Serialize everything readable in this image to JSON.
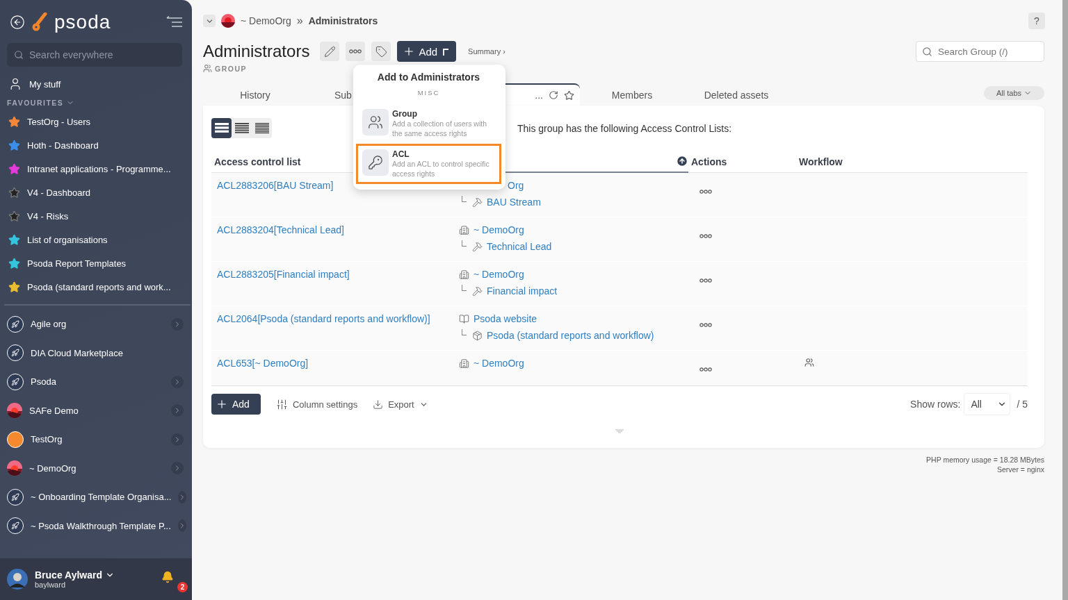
{
  "sidebar": {
    "logo": "psoda",
    "search": {
      "placeholder": "Search everywhere"
    },
    "my_stuff": "My stuff",
    "favourites_heading": "FAVOURITES",
    "favourites": [
      {
        "label": "TestOrg - Users",
        "color": "#f5873a"
      },
      {
        "label": "Hoth - Dashboard",
        "color": "#3b8fe8"
      },
      {
        "label": "Intranet applications - Programme...",
        "color": "#e33ad8"
      },
      {
        "label": "V4 - Dashboard",
        "color": "#222222"
      },
      {
        "label": "V4 - Risks",
        "color": "#222222"
      },
      {
        "label": "List of organisations",
        "color": "#35c4dc"
      },
      {
        "label": "Psoda Report Templates",
        "color": "#35c4dc"
      },
      {
        "label": "Psoda (standard reports and work...",
        "color": "#e8bd32"
      }
    ],
    "organisations": [
      {
        "label": "Agile org",
        "kind": "rocket",
        "expandable": true
      },
      {
        "label": "DIA Cloud Marketplace",
        "kind": "rocket",
        "expandable": false
      },
      {
        "label": "Psoda",
        "kind": "rocket",
        "expandable": true
      },
      {
        "label": "SAFe Demo",
        "kind": "picture",
        "expandable": true
      },
      {
        "label": "TestOrg",
        "kind": "orange",
        "expandable": true
      },
      {
        "label": "~ DemoOrg",
        "kind": "picture",
        "expandable": true
      },
      {
        "label": "~ Onboarding Template Organisa...",
        "kind": "rocket",
        "expandable": true
      },
      {
        "label": "~ Psoda Walkthrough Template P...",
        "kind": "rocket",
        "expandable": true
      }
    ],
    "user": {
      "name": "Bruce Aylward",
      "username": "baylward",
      "notifications": "2"
    }
  },
  "breadcrumb": {
    "parent": "~ DemoOrg",
    "separator": "»",
    "current": "Administrators"
  },
  "header": {
    "title": "Administrators",
    "type": "GROUP",
    "add_button": "Add",
    "summary_link": "Summary ›",
    "search": {
      "placeholder": "Search Group (/)"
    },
    "help": "?"
  },
  "tabs": [
    {
      "label": "History",
      "selected": false
    },
    {
      "label": "Sub",
      "selected": false
    },
    {
      "label": "...",
      "selected": true
    },
    {
      "label": "Members",
      "selected": false
    },
    {
      "label": "Deleted assets",
      "selected": false
    }
  ],
  "all_tabs": "All tabs",
  "view_modes": [
    {
      "kind": "comfortable",
      "selected": true
    },
    {
      "kind": "compact",
      "selected": false
    },
    {
      "kind": "dense",
      "selected": false
    }
  ],
  "intro": "This group has the following Access Control Lists:",
  "table": {
    "columns": [
      {
        "label": "Access control list",
        "sorted": false
      },
      {
        "sorted": true
      },
      {
        "label": "Actions",
        "sorted": false
      },
      {
        "label": "Workflow",
        "sorted": false
      }
    ],
    "rows": [
      {
        "acl": "ACL2883206[BAU Stream]",
        "hierarchy": [
          {
            "kind": "clipped",
            "label": "Org"
          },
          {
            "kind": "team",
            "label": "BAU Stream"
          }
        ],
        "has_workflow": false
      },
      {
        "acl": "ACL2883204[Technical Lead]",
        "hierarchy": [
          {
            "kind": "org",
            "label": "~ DemoOrg"
          },
          {
            "kind": "team",
            "label": "Technical Lead"
          }
        ],
        "has_workflow": false
      },
      {
        "acl": "ACL2883205[Financial impact]",
        "hierarchy": [
          {
            "kind": "org",
            "label": "~ DemoOrg"
          },
          {
            "kind": "team",
            "label": "Financial impact"
          }
        ],
        "has_workflow": false
      },
      {
        "acl": "ACL2064[Psoda (standard reports and workflow)]",
        "hierarchy": [
          {
            "kind": "website",
            "label": "Psoda website"
          },
          {
            "kind": "product",
            "label": "Psoda (standard reports and workflow)"
          }
        ],
        "has_workflow": false
      },
      {
        "acl": "ACL653[~ DemoOrg]",
        "hierarchy": [
          {
            "kind": "org",
            "label": "~ DemoOrg"
          }
        ],
        "has_workflow": true
      }
    ]
  },
  "footer_bar": {
    "add": "Add",
    "column_settings": "Column settings",
    "export": "Export",
    "show_rows_label": "Show rows:",
    "show_rows_value": "All",
    "total": "/ 5"
  },
  "server_info": [
    "PHP memory usage = 18.28 MBytes",
    "Server = nginx"
  ],
  "add_menu": {
    "title": "Add to Administrators",
    "section": "MISC",
    "items": [
      {
        "kind": "group",
        "title": "Group",
        "description": "Add a collection of users with the same access rights",
        "highlighted": false
      },
      {
        "kind": "acl",
        "title": "ACL",
        "description": "Add an ACL to control specific access rights",
        "highlighted": true
      }
    ]
  }
}
